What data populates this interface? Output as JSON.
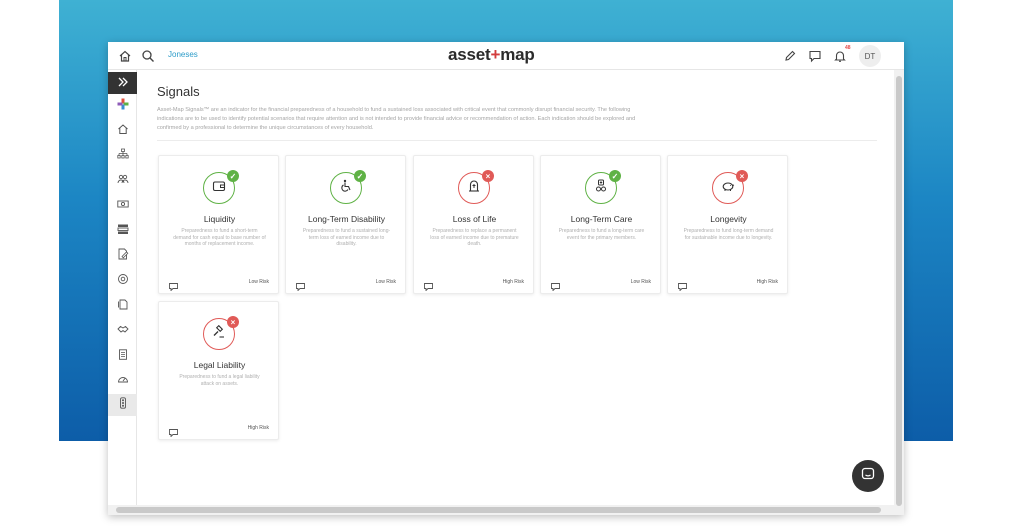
{
  "header": {
    "household": "Joneses",
    "logo_left": "asset",
    "logo_plus": "+",
    "logo_right": "map",
    "notification_count": "48",
    "user_initials": "DT"
  },
  "page": {
    "title": "Signals",
    "description": "Asset-Map Signals™ are an indicator for the financial preparedness of a household to fund a sustained loss associated with critical event that commonly disrupt financial security. The following indications are to be used to identify potential scenarios that require attention and is not intended to provide financial advice or recommendation of action. Each indication should be explored and confirmed by a professional to determine the unique circumstances of every household."
  },
  "signals": [
    {
      "name": "Liquidity",
      "description": "Preparedness to fund a short-term demand for cash equal to base number of months of replacement income.",
      "risk": "Low Risk",
      "status": "ok",
      "icon": "wallet-icon"
    },
    {
      "name": "Long-Term Disability",
      "description": "Preparedness to fund a sustained long-term loss of earned income due to disability.",
      "risk": "Low Risk",
      "status": "ok",
      "icon": "wheelchair-icon"
    },
    {
      "name": "Loss of Life",
      "description": "Preparedness to replace a permanent loss of earned income due to premature death.",
      "risk": "High Risk",
      "status": "alert",
      "icon": "tombstone-icon"
    },
    {
      "name": "Long-Term Care",
      "description": "Preparedness to fund a long-term care event for the primary members.",
      "risk": "Low Risk",
      "status": "ok",
      "icon": "caregiver-icon"
    },
    {
      "name": "Longevity",
      "description": "Preparedness to fund long-term demand for sustainable income due to longevity.",
      "risk": "High Risk",
      "status": "alert",
      "icon": "piggy-bank-icon"
    },
    {
      "name": "Legal Liability",
      "description": "Preparedness to fund a legal liability attack on assets.",
      "risk": "High Risk",
      "status": "alert",
      "icon": "gavel-icon"
    }
  ],
  "colors": {
    "ok": "#5fb245",
    "alert": "#e05a57",
    "accent": "#2d9cc9"
  }
}
